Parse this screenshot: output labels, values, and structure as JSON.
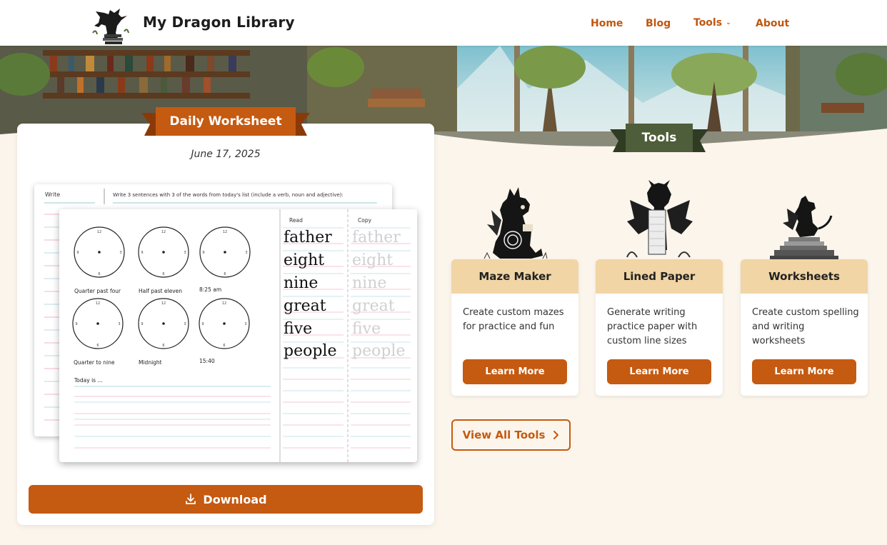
{
  "header": {
    "site_title": "My Dragon Library",
    "nav": {
      "home": "Home",
      "blog": "Blog",
      "tools": "Tools",
      "about": "About"
    }
  },
  "worksheet": {
    "ribbon_label": "Daily Worksheet",
    "date": "June 17, 2025",
    "back_sheet": {
      "write_label": "Write",
      "instruction": "Write 3 sentences with 3 of the words from today's list (include a verb, noun and adjective):"
    },
    "front_sheet": {
      "clock_labels": [
        "Quarter past four",
        "Half past eleven",
        "8:25 am",
        "Quarter to nine",
        "Midnight",
        "15:40"
      ],
      "today_label": "Today is ...",
      "read_label": "Read",
      "copy_label": "Copy",
      "words": [
        "father",
        "eight",
        "nine",
        "great",
        "five",
        "people"
      ]
    },
    "download_label": "Download"
  },
  "tools": {
    "ribbon_label": "Tools",
    "cards": [
      {
        "title": "Maze Maker",
        "description": "Create custom mazes for practice and fun",
        "button": "Learn More"
      },
      {
        "title": "Lined Paper",
        "description": "Generate writing practice paper with custom line sizes",
        "button": "Learn More"
      },
      {
        "title": "Worksheets",
        "description": "Create custom spelling and writing worksheets",
        "button": "Learn More"
      }
    ],
    "view_all_label": "View All Tools"
  },
  "colors": {
    "accent": "#c55a11",
    "ribbon_green": "#4f5e3a",
    "card_header": "#f1d5a5",
    "background": "#fbf5ec"
  },
  "icons": [
    "dragon-logo-icon",
    "chevron-down-icon",
    "download-icon",
    "chevron-right-icon"
  ]
}
